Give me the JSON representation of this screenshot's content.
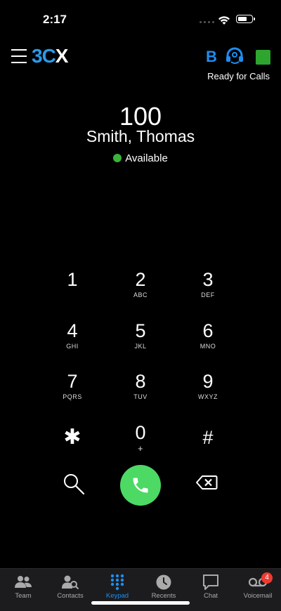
{
  "status_bar": {
    "time": "2:17",
    "wifi_icon": "wifi-icon",
    "battery_icon": "battery-icon"
  },
  "header": {
    "logo_part1": "3C",
    "logo_part2": "X",
    "b_badge": "B",
    "status_text": "Ready for Calls",
    "status_color": "#2ea52e",
    "accent": "#1e8ef0"
  },
  "caller": {
    "extension": "100",
    "name": "Smith, Thomas",
    "presence": "Available",
    "presence_color": "#3bb33b"
  },
  "keypad": {
    "keys": [
      {
        "digit": "1",
        "letters": ""
      },
      {
        "digit": "2",
        "letters": "ABC"
      },
      {
        "digit": "3",
        "letters": "DEF"
      },
      {
        "digit": "4",
        "letters": "GHI"
      },
      {
        "digit": "5",
        "letters": "JKL"
      },
      {
        "digit": "6",
        "letters": "MNO"
      },
      {
        "digit": "7",
        "letters": "PQRS"
      },
      {
        "digit": "8",
        "letters": "TUV"
      },
      {
        "digit": "9",
        "letters": "WXYZ"
      },
      {
        "digit": "✱",
        "letters": ""
      },
      {
        "digit": "0",
        "letters": "+"
      },
      {
        "digit": "#",
        "letters": ""
      }
    ],
    "call_color": "#4cd964"
  },
  "tabs": [
    {
      "label": "Team",
      "icon": "team-icon"
    },
    {
      "label": "Contacts",
      "icon": "contacts-icon"
    },
    {
      "label": "Keypad",
      "icon": "keypad-icon",
      "active": true
    },
    {
      "label": "Recents",
      "icon": "recents-icon"
    },
    {
      "label": "Chat",
      "icon": "chat-icon"
    },
    {
      "label": "Voicemail",
      "icon": "voicemail-icon",
      "badge": "4"
    }
  ]
}
